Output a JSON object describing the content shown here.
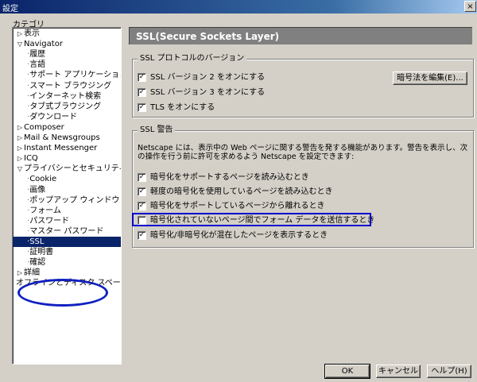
{
  "window": {
    "title": "設定",
    "close": "×"
  },
  "category_label": "カテゴリ",
  "tree": [
    {
      "label": "表示",
      "depth": 0,
      "twisty": "▷"
    },
    {
      "label": "Navigator",
      "depth": 0,
      "twisty": "▽"
    },
    {
      "label": "履歴",
      "depth": 1
    },
    {
      "label": "言語",
      "depth": 1
    },
    {
      "label": "サポート アプリケーション",
      "depth": 1
    },
    {
      "label": "スマート ブラウジング",
      "depth": 1
    },
    {
      "label": "インターネット検索",
      "depth": 1
    },
    {
      "label": "タブ式ブラウジング",
      "depth": 1
    },
    {
      "label": "ダウンロード",
      "depth": 1
    },
    {
      "label": "Composer",
      "depth": 0,
      "twisty": "▷"
    },
    {
      "label": "Mail & Newsgroups",
      "depth": 0,
      "twisty": "▷"
    },
    {
      "label": "Instant Messenger",
      "depth": 0,
      "twisty": "▷"
    },
    {
      "label": "ICQ",
      "depth": 0,
      "twisty": "▷"
    },
    {
      "label": "プライバシーとセキュリティ",
      "depth": 0,
      "twisty": "▽"
    },
    {
      "label": "Cookie",
      "depth": 1
    },
    {
      "label": "画像",
      "depth": 1
    },
    {
      "label": "ポップアップ ウィンドウ",
      "depth": 1
    },
    {
      "label": "フォーム",
      "depth": 1
    },
    {
      "label": "パスワード",
      "depth": 1
    },
    {
      "label": "マスター パスワード",
      "depth": 1
    },
    {
      "label": "SSL",
      "depth": 1,
      "selected": true
    },
    {
      "label": "証明書",
      "depth": 1
    },
    {
      "label": "確認",
      "depth": 1
    },
    {
      "label": "詳細",
      "depth": 0,
      "twisty": "▷"
    },
    {
      "label": "オフラインとディスク スペース",
      "depth": 0
    }
  ],
  "header": "SSL(Secure Sockets Layer)",
  "protocol_group": {
    "label": "SSL プロトコルのバージョン",
    "items": [
      {
        "label": "SSL バージョン 2 をオンにする",
        "checked": true
      },
      {
        "label": "SSL バージョン 3 をオンにする",
        "checked": true
      },
      {
        "label": "TLS をオンにする",
        "checked": true
      }
    ],
    "edit_button": "暗号法を編集(E)..."
  },
  "warning_group": {
    "label": "SSL 警告",
    "description": "Netscape には、表示中の Web ページに関する警告を発する機能があります。警告を表示し、次の操作を行う前に許可を求めるよう Netscape を設定できます:",
    "items": [
      {
        "label": "暗号化をサポートするページを読み込むとき",
        "checked": true
      },
      {
        "label": "軽度の暗号化を使用しているページを読み込むとき",
        "checked": true
      },
      {
        "label": "暗号化をサポートしているページから離れるとき",
        "checked": true
      },
      {
        "label": "暗号化されていないページ間でフォーム データを送信するとき",
        "checked": false
      },
      {
        "label": "暗号化/非暗号化が混在したページを表示するとき",
        "checked": true
      }
    ]
  },
  "buttons": {
    "ok": "OK",
    "cancel": "キャンセル",
    "help": "ヘルプ(H)"
  }
}
